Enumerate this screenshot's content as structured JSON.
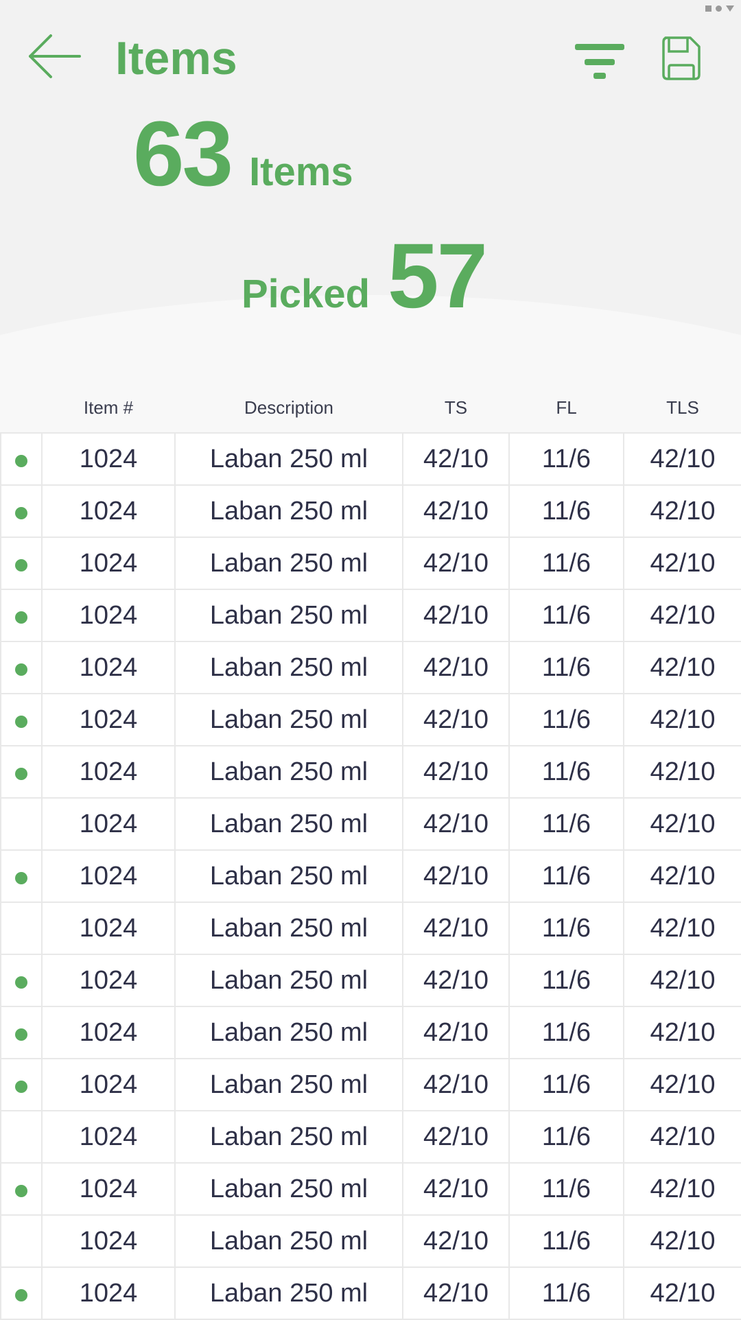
{
  "header": {
    "title": "Items",
    "back_icon": "arrow-left-icon",
    "filter_icon": "filter-icon",
    "save_icon": "floppy-disk-icon"
  },
  "stats": {
    "total_count": "63",
    "total_label": "Items",
    "picked_label": "Picked",
    "picked_count": "57"
  },
  "colors": {
    "accent": "#5aac5e",
    "text": "#2e3047",
    "background": "#f2f2f2"
  },
  "table": {
    "columns": [
      "Item #",
      "Description",
      "TS",
      "FL",
      "TLS"
    ],
    "rows": [
      {
        "picked": true,
        "item": "1024",
        "description": "Laban 250 ml",
        "ts": "42/10",
        "fl": "11/6",
        "tls": "42/10"
      },
      {
        "picked": true,
        "item": "1024",
        "description": "Laban 250 ml",
        "ts": "42/10",
        "fl": "11/6",
        "tls": "42/10"
      },
      {
        "picked": true,
        "item": "1024",
        "description": "Laban 250 ml",
        "ts": "42/10",
        "fl": "11/6",
        "tls": "42/10"
      },
      {
        "picked": true,
        "item": "1024",
        "description": "Laban 250 ml",
        "ts": "42/10",
        "fl": "11/6",
        "tls": "42/10"
      },
      {
        "picked": true,
        "item": "1024",
        "description": "Laban 250 ml",
        "ts": "42/10",
        "fl": "11/6",
        "tls": "42/10"
      },
      {
        "picked": true,
        "item": "1024",
        "description": "Laban 250 ml",
        "ts": "42/10",
        "fl": "11/6",
        "tls": "42/10"
      },
      {
        "picked": true,
        "item": "1024",
        "description": "Laban 250 ml",
        "ts": "42/10",
        "fl": "11/6",
        "tls": "42/10"
      },
      {
        "picked": false,
        "item": "1024",
        "description": "Laban 250 ml",
        "ts": "42/10",
        "fl": "11/6",
        "tls": "42/10"
      },
      {
        "picked": true,
        "item": "1024",
        "description": "Laban 250 ml",
        "ts": "42/10",
        "fl": "11/6",
        "tls": "42/10"
      },
      {
        "picked": false,
        "item": "1024",
        "description": "Laban 250 ml",
        "ts": "42/10",
        "fl": "11/6",
        "tls": "42/10"
      },
      {
        "picked": true,
        "item": "1024",
        "description": "Laban 250 ml",
        "ts": "42/10",
        "fl": "11/6",
        "tls": "42/10"
      },
      {
        "picked": true,
        "item": "1024",
        "description": "Laban 250 ml",
        "ts": "42/10",
        "fl": "11/6",
        "tls": "42/10"
      },
      {
        "picked": true,
        "item": "1024",
        "description": "Laban 250 ml",
        "ts": "42/10",
        "fl": "11/6",
        "tls": "42/10"
      },
      {
        "picked": false,
        "item": "1024",
        "description": "Laban 250 ml",
        "ts": "42/10",
        "fl": "11/6",
        "tls": "42/10"
      },
      {
        "picked": true,
        "item": "1024",
        "description": "Laban 250 ml",
        "ts": "42/10",
        "fl": "11/6",
        "tls": "42/10"
      },
      {
        "picked": false,
        "item": "1024",
        "description": "Laban 250 ml",
        "ts": "42/10",
        "fl": "11/6",
        "tls": "42/10"
      },
      {
        "picked": true,
        "item": "1024",
        "description": "Laban 250 ml",
        "ts": "42/10",
        "fl": "11/6",
        "tls": "42/10"
      }
    ]
  }
}
